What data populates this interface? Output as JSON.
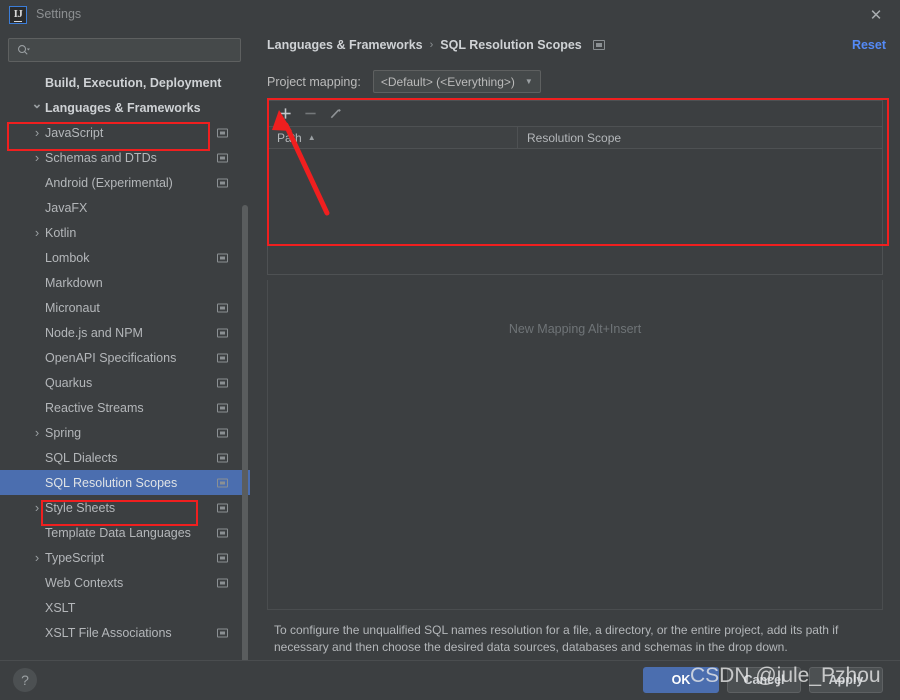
{
  "window": {
    "title": "Settings",
    "app_icon": "intellij-idea-logo",
    "close_icon": "close-icon"
  },
  "sidebar": {
    "search": {
      "placeholder": "",
      "value": "",
      "icon": "search-icon"
    },
    "items": [
      {
        "label": "Build, Execution, Deployment",
        "kind": "group",
        "chevron": "",
        "badge": false,
        "selected": false
      },
      {
        "label": "Languages & Frameworks",
        "kind": "group",
        "chevron": "v",
        "badge": false,
        "selected": false
      },
      {
        "label": "JavaScript",
        "kind": "child",
        "chevron": ">",
        "badge": true,
        "selected": false
      },
      {
        "label": "Schemas and DTDs",
        "kind": "child",
        "chevron": ">",
        "badge": true,
        "selected": false
      },
      {
        "label": "Android (Experimental)",
        "kind": "child",
        "chevron": "",
        "badge": true,
        "selected": false
      },
      {
        "label": "JavaFX",
        "kind": "child",
        "chevron": "",
        "badge": false,
        "selected": false
      },
      {
        "label": "Kotlin",
        "kind": "child",
        "chevron": ">",
        "badge": false,
        "selected": false
      },
      {
        "label": "Lombok",
        "kind": "child",
        "chevron": "",
        "badge": true,
        "selected": false
      },
      {
        "label": "Markdown",
        "kind": "child",
        "chevron": "",
        "badge": false,
        "selected": false
      },
      {
        "label": "Micronaut",
        "kind": "child",
        "chevron": "",
        "badge": true,
        "selected": false
      },
      {
        "label": "Node.js and NPM",
        "kind": "child",
        "chevron": "",
        "badge": true,
        "selected": false
      },
      {
        "label": "OpenAPI Specifications",
        "kind": "child",
        "chevron": "",
        "badge": true,
        "selected": false
      },
      {
        "label": "Quarkus",
        "kind": "child",
        "chevron": "",
        "badge": true,
        "selected": false
      },
      {
        "label": "Reactive Streams",
        "kind": "child",
        "chevron": "",
        "badge": true,
        "selected": false
      },
      {
        "label": "Spring",
        "kind": "child",
        "chevron": ">",
        "badge": true,
        "selected": false
      },
      {
        "label": "SQL Dialects",
        "kind": "child",
        "chevron": "",
        "badge": true,
        "selected": false
      },
      {
        "label": "SQL Resolution Scopes",
        "kind": "child",
        "chevron": "",
        "badge": true,
        "selected": true
      },
      {
        "label": "Style Sheets",
        "kind": "child",
        "chevron": ">",
        "badge": true,
        "selected": false
      },
      {
        "label": "Template Data Languages",
        "kind": "child",
        "chevron": "",
        "badge": true,
        "selected": false
      },
      {
        "label": "TypeScript",
        "kind": "child",
        "chevron": ">",
        "badge": true,
        "selected": false
      },
      {
        "label": "Web Contexts",
        "kind": "child",
        "chevron": "",
        "badge": true,
        "selected": false
      },
      {
        "label": "XSLT",
        "kind": "child",
        "chevron": "",
        "badge": false,
        "selected": false
      },
      {
        "label": "XSLT File Associations",
        "kind": "child",
        "chevron": "",
        "badge": true,
        "selected": false
      }
    ]
  },
  "main": {
    "breadcrumb": {
      "parent": "Languages & Frameworks",
      "separator": "›",
      "current": "SQL Resolution Scopes",
      "icon": "project-scope-icon"
    },
    "reset_label": "Reset",
    "project_mapping": {
      "label": "Project mapping:",
      "selected": "<Default> (<Everything>)",
      "caret": "▼"
    },
    "toolbar": {
      "add_label": "+",
      "remove_label": "−",
      "edit_label": "edit-pencil-icon"
    },
    "table": {
      "columns": [
        "Path",
        "Resolution Scope"
      ],
      "sort_column": "Path",
      "sort_arrow": "▲",
      "rows": []
    },
    "detail_hint": "New Mapping Alt+Insert",
    "help_text": "To configure the unqualified SQL names resolution for a file, a directory, or the entire project, add its path if necessary and then choose the desired data sources, databases and schemas in the drop down."
  },
  "footer": {
    "help_icon": "question-mark-icon",
    "help_label": "?",
    "ok_label": "OK",
    "cancel_label": "Cancel",
    "apply_label": "Apply"
  },
  "overlay": {
    "watermark": "CSDN @jule_Pzhou",
    "annotation_color": "#f01f1f"
  }
}
